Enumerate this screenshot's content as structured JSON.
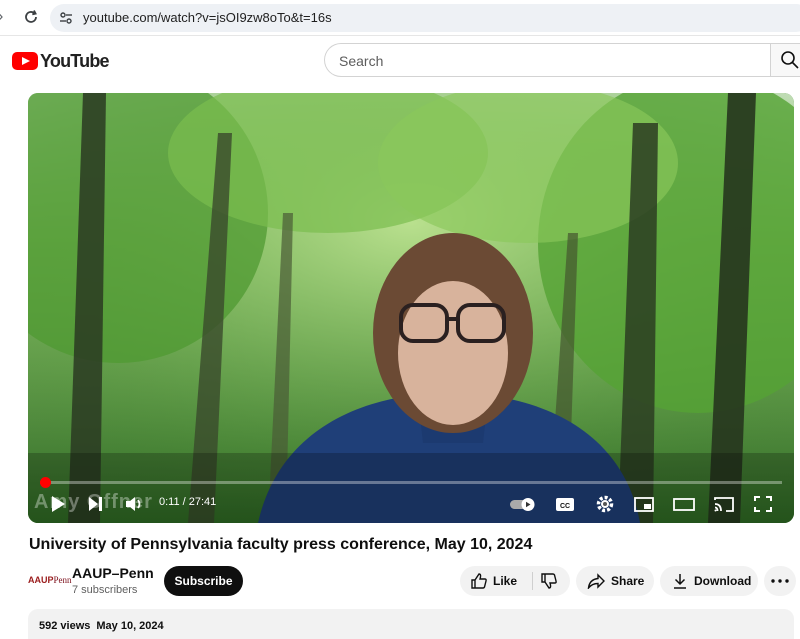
{
  "browser": {
    "url": "youtube.com/watch?v=jsOI9zw8oTo&t=16s"
  },
  "masthead": {
    "logo_text": "YouTube",
    "search_placeholder": "Search"
  },
  "player": {
    "watermark_text": "Amy Offner",
    "time_display": "0:11 / 27:41",
    "progress_fraction": 0.0066,
    "icons": [
      "play-icon",
      "next-icon",
      "volume-icon",
      "autoplay-toggle",
      "cc-icon",
      "settings-icon",
      "miniplayer-icon",
      "theater-icon",
      "cast-icon",
      "fullscreen-icon"
    ]
  },
  "video": {
    "title": "University of Pennsylvania faculty press conference, May 10, 2024"
  },
  "channel": {
    "name": "AAUP–Penn",
    "subscribers": "7 subscribers",
    "avatar_text_a": "AAUP",
    "avatar_text_b": "Penn",
    "subscribe_label": "Subscribe"
  },
  "actions": {
    "like_label": "Like",
    "share_label": "Share",
    "download_label": "Download"
  },
  "description": {
    "views": "592 views",
    "date": "May 10, 2024"
  },
  "colors": {
    "brand_red": "#ff0000",
    "pill_bg": "#f2f2f2"
  }
}
